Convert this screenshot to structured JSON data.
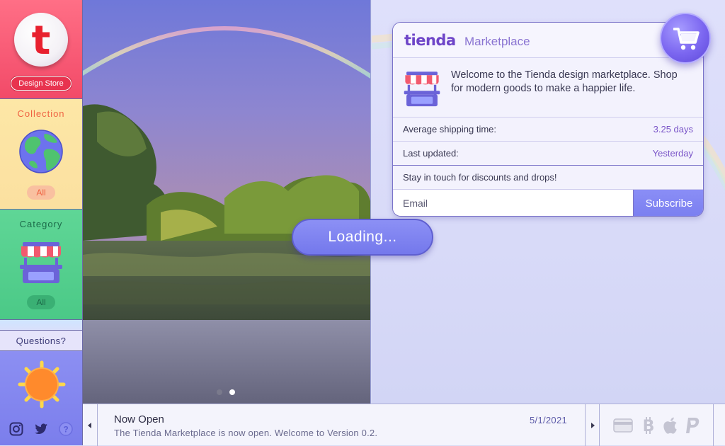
{
  "sidebar": {
    "logo_letter": "t",
    "brand_badge": "Design Store",
    "collection": {
      "title": "Collection",
      "filter": "All",
      "icon": "globe-icon"
    },
    "category": {
      "title": "Category",
      "filter": "All",
      "icon": "market-stall-icon"
    },
    "questions": "Questions?",
    "social": [
      "instagram-icon",
      "twitter-icon",
      "help-icon"
    ]
  },
  "hero": {
    "slides": 2,
    "active_slide": 2
  },
  "card": {
    "brand": "tienda",
    "brand_sub": "Marketplace",
    "intro": "Welcome to the Tienda design marketplace. Shop for modern goods to make a happier life.",
    "shipping_label": "Average shipping time:",
    "shipping_value": "3.25 days",
    "updated_label": "Last updated:",
    "updated_value": "Yesterday",
    "touch": "Stay in touch for discounts and drops!",
    "email_placeholder": "Email",
    "subscribe": "Subscribe"
  },
  "loading": "Loading...",
  "news": {
    "title": "Now Open",
    "date": "5/1/2021",
    "body": "The Tienda Marketplace is now open. Welcome to Version 0.2."
  },
  "payments": [
    "credit-card-icon",
    "bitcoin-icon",
    "apple-icon",
    "paypal-icon"
  ],
  "colors": {
    "accent": "#7b7ff0",
    "brand_red": "#e8212f",
    "brand_purple": "#6e45c8"
  }
}
